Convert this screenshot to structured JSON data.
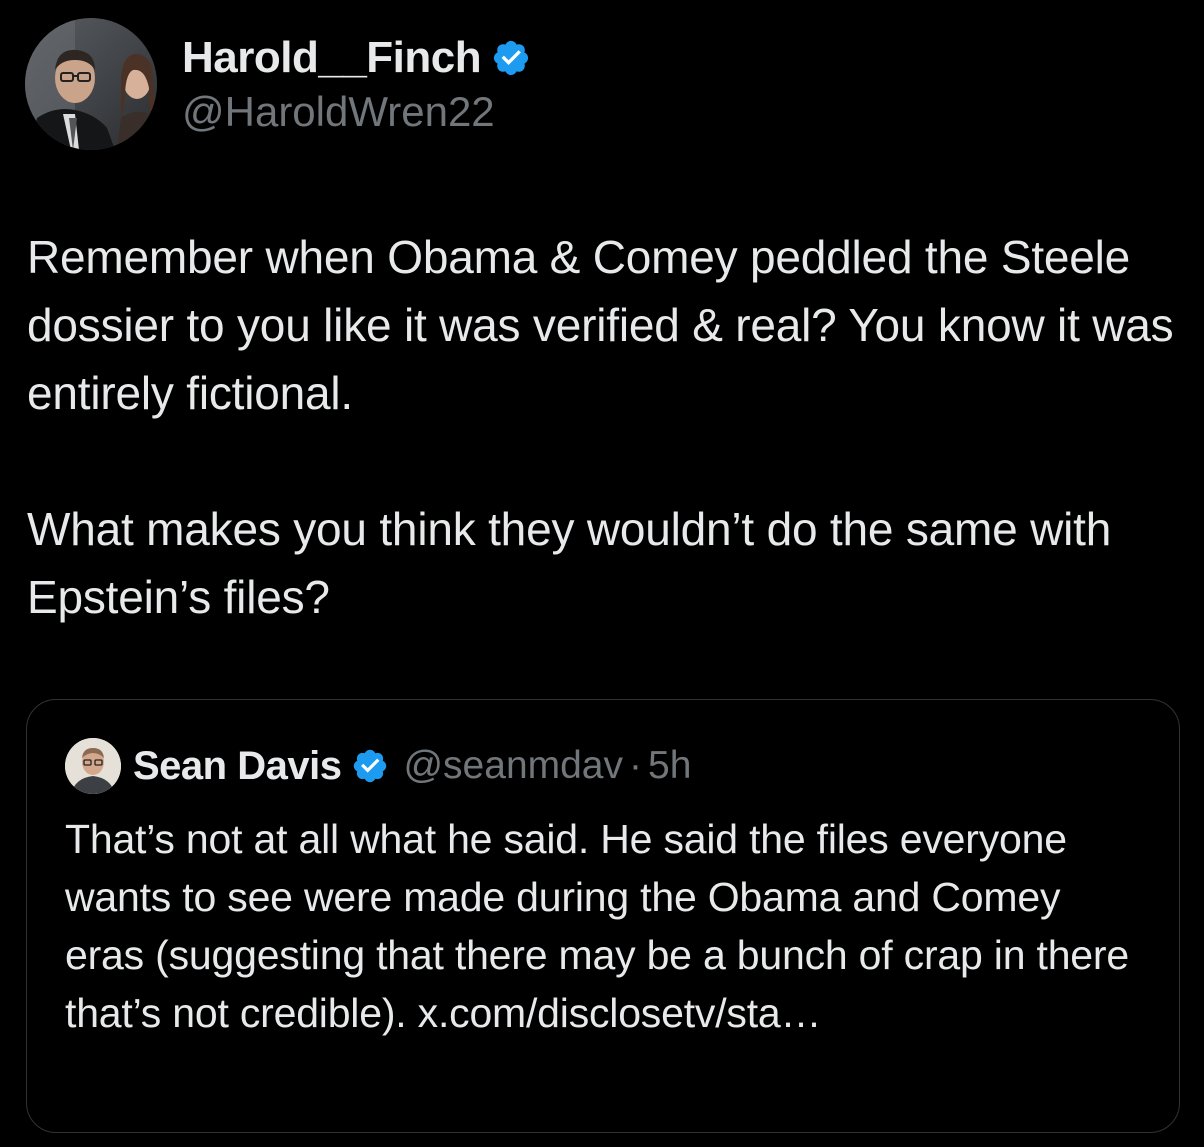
{
  "author": {
    "name": "Harold__Finch",
    "handle": "@HaroldWren22",
    "verified": true,
    "avatar_icon": "avatar-photo"
  },
  "tweet": {
    "text": "Remember when Obama & Comey peddled the Steele dossier to you like it was verified & real? You know it was entirely fictional.\n\nWhat makes you think they wouldn’t do the same with Epstein’s files?"
  },
  "quoted_tweet": {
    "author_name": "Sean Davis",
    "verified": true,
    "handle": "@seanmdav",
    "separator": "·",
    "time": "5h",
    "text": "That’s not at all what he said. He said the files everyone wants to see were made during the Obama and Comey eras (suggesting that there may be a bunch of crap in there that’s not credible). x.com/disclosetv/sta…"
  },
  "colors": {
    "background": "#000000",
    "text_primary": "#e7e9ea",
    "text_secondary": "#71767b",
    "verified_badge": "#1d9bf0",
    "card_border": "#2f3336"
  }
}
